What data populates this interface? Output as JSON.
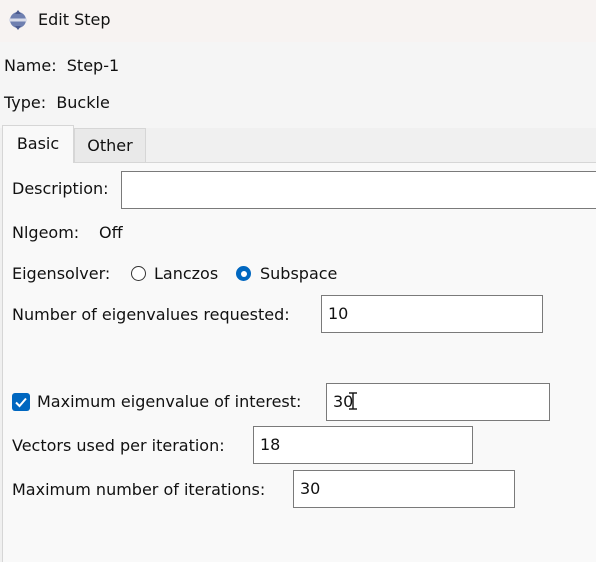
{
  "window": {
    "title": "Edit Step"
  },
  "step": {
    "name_label": "Name:",
    "name_value": "Step-1",
    "type_label": "Type:",
    "type_value": "Buckle"
  },
  "tabs": [
    {
      "label": "Basic",
      "active": true
    },
    {
      "label": "Other",
      "active": false
    }
  ],
  "basic": {
    "description_label": "Description:",
    "description_value": "",
    "nlgeom_label": "Nlgeom:",
    "nlgeom_value": "Off",
    "eigensolver_label": "Eigensolver:",
    "eigensolver_options": [
      "Lanczos",
      "Subspace"
    ],
    "eigensolver_selected": "Subspace",
    "num_eigenvalues_label": "Number of eigenvalues requested:",
    "num_eigenvalues_value": "10",
    "max_eigenvalue_checked": true,
    "max_eigenvalue_label": "Maximum eigenvalue of interest:",
    "max_eigenvalue_value": "30",
    "vectors_label": "Vectors used per iteration:",
    "vectors_value": "18",
    "max_iterations_label": "Maximum number of iterations:",
    "max_iterations_value": "30"
  },
  "colors": {
    "accent": "#0067c0",
    "titlebar": "#f7f3f2"
  },
  "icons": {
    "app": "abaqus-step-icon",
    "check": "check-icon",
    "cursor": "text-cursor-icon"
  }
}
